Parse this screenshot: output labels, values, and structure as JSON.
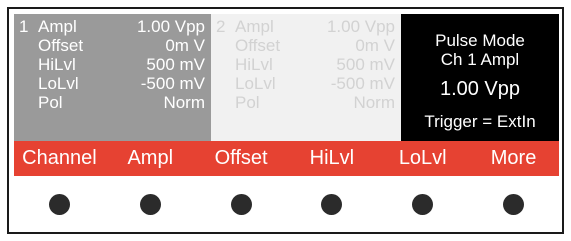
{
  "channel1": {
    "number": "1",
    "rows": [
      {
        "label": "Ampl",
        "value": "1.00 Vpp"
      },
      {
        "label": "Offset",
        "value": "0m V"
      },
      {
        "label": "HiLvl",
        "value": "500 mV"
      },
      {
        "label": "LoLvl",
        "value": "-500 mV"
      },
      {
        "label": "Pol",
        "value": "Norm"
      }
    ]
  },
  "channel2": {
    "number": "2",
    "rows": [
      {
        "label": "Ampl",
        "value": "1.00 Vpp"
      },
      {
        "label": "Offset",
        "value": "0m V"
      },
      {
        "label": "HiLvl",
        "value": "500 mV"
      },
      {
        "label": "LoLvl",
        "value": "-500 mV"
      },
      {
        "label": "Pol",
        "value": "Norm"
      }
    ]
  },
  "info": {
    "mode": "Pulse Mode",
    "channel": "Ch 1 Ampl",
    "value": "1.00 Vpp",
    "trigger": "Trigger = ExtIn"
  },
  "softkeys": [
    {
      "label": "Channel"
    },
    {
      "label": "Ampl"
    },
    {
      "label": "Offset"
    },
    {
      "label": "HiLvl"
    },
    {
      "label": "LoLvl"
    },
    {
      "label": "More"
    }
  ],
  "colors": {
    "softkey_bar": "#e64232",
    "ch1_panel": "#9a9a9a",
    "ch2_panel": "#f1f1f1",
    "info_panel": "#000000",
    "knob": "#2b2b2b"
  }
}
